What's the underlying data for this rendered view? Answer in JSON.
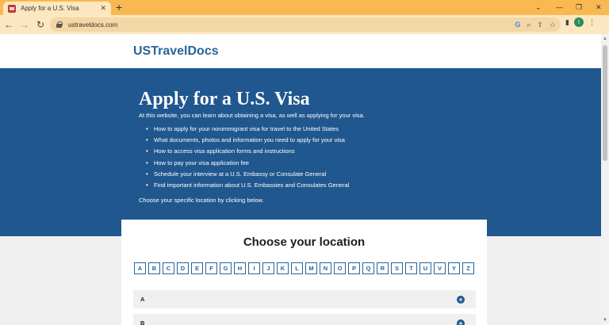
{
  "browser": {
    "tab_title": "Apply for a U.S. Visa",
    "tab_close": "✕",
    "new_tab": "+",
    "url": "ustraveldocs.com",
    "profile_initial": "I",
    "window_controls": {
      "dropdown": "⌄",
      "minimize": "—",
      "restore": "❐",
      "close": "✕"
    }
  },
  "site": {
    "logo": "USTravelDocs"
  },
  "hero": {
    "title": "Apply for a U.S. Visa",
    "intro": "At this website, you can learn about obtaining a visa, as well as applying for your visa.",
    "items": [
      "How to apply for your nonimmigrant visa for travel to the United States",
      "What documents, photos and information you need to apply for your visa",
      "How to access visa application forms and instructions",
      "How to pay your visa application fee",
      "Schedule your interview at a U.S. Embassy or Consulate General",
      "Find important information about U.S. Embassies and Consulates General"
    ],
    "outro": "Choose your specific location by clicking below."
  },
  "location": {
    "title": "Choose your location",
    "letters": [
      "A",
      "B",
      "C",
      "D",
      "E",
      "F",
      "G",
      "H",
      "I",
      "J",
      "K",
      "L",
      "M",
      "N",
      "O",
      "P",
      "Q",
      "R",
      "S",
      "T",
      "U",
      "V",
      "Y",
      "Z"
    ],
    "sections": [
      "A",
      "B"
    ]
  },
  "colors": {
    "chrome_tabstrip": "#f9b851",
    "chrome_toolbar": "#fde7c0",
    "hero_bg": "#20578f",
    "brand_blue": "#2a6496"
  }
}
